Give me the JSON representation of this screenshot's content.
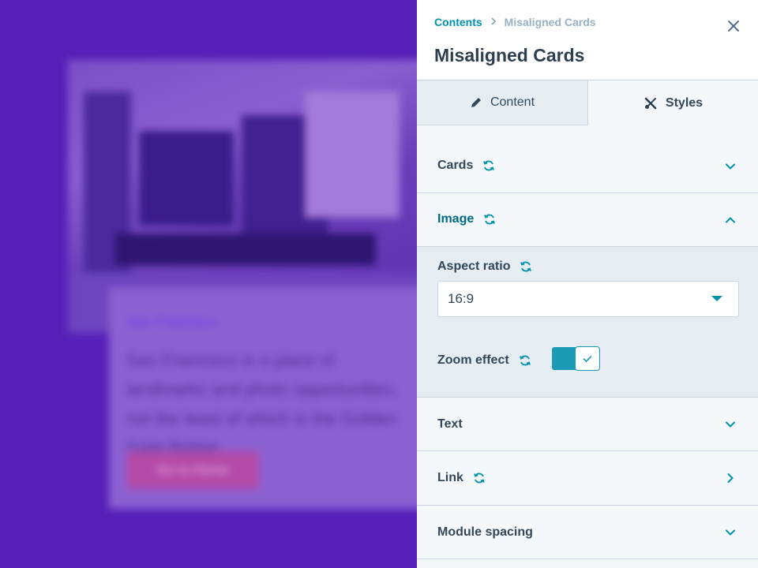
{
  "preview": {
    "city": "San Francisco",
    "text": "San Francisco is a place of landmarks and photo opportunities, not the least of which is the Golden Gate Bridge",
    "button_label": "Go to Home"
  },
  "panel": {
    "breadcrumb": {
      "root": "Contents",
      "current": "Misaligned Cards"
    },
    "title": "Misaligned Cards",
    "tabs": [
      {
        "label": "Content",
        "icon": "pencil-icon",
        "active": false
      },
      {
        "label": "Styles",
        "icon": "styles-icon",
        "active": true
      }
    ],
    "sections": {
      "cards": {
        "label": "Cards",
        "expanded": false
      },
      "image": {
        "label": "Image",
        "expanded": true
      },
      "text": {
        "label": "Text",
        "expanded": false
      },
      "link": {
        "label": "Link",
        "expanded": false
      },
      "module_spacing": {
        "label": "Module spacing",
        "expanded": false
      }
    },
    "image_fields": {
      "aspect_ratio_label": "Aspect ratio",
      "aspect_ratio_value": "16:9",
      "zoom_effect_label": "Zoom effect",
      "zoom_effect_on": true
    }
  },
  "colors": {
    "accent": "#0091ae",
    "toggle": "#1a9ab4",
    "text": "#33475b",
    "background": "#5620b8"
  }
}
